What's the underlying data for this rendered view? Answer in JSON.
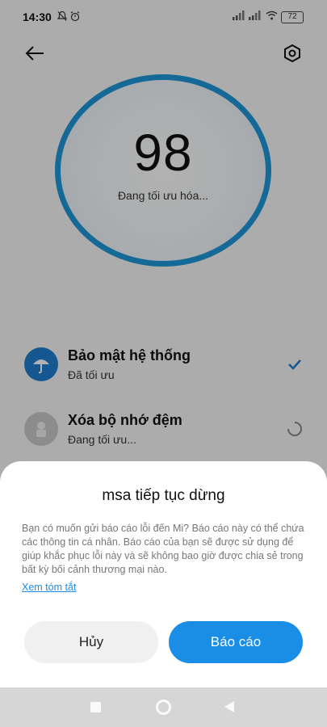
{
  "status_bar": {
    "time": "14:30",
    "icons": [
      "bell-off-icon",
      "alarm-icon"
    ],
    "right_icons": [
      "signal-icon",
      "signal-icon",
      "wifi-icon"
    ],
    "battery": "72"
  },
  "header": {
    "back_icon": "arrow-left-icon",
    "settings_icon": "settings-hexagon-icon"
  },
  "score": {
    "value": "98",
    "status": "Đang tối ưu hóa...",
    "ring_color": "#1f97d8"
  },
  "tasks": [
    {
      "title": "Bảo mật hệ thống",
      "subtitle": "Đã tối ưu",
      "icon": "umbrella-icon",
      "state_icon": "check-icon"
    },
    {
      "title": "Xóa bộ nhớ đệm",
      "subtitle": "Đang tối ưu...",
      "icon": "broom-icon",
      "state_icon": "spinner-icon"
    }
  ],
  "dialog": {
    "title": "msa tiếp tục dừng",
    "message": "Bạn có muốn gửi báo cáo lỗi đến Mi? Báo cáo này có thể chứa các thông tin cá nhân. Báo cáo của bạn sẽ được sử dụng để giúp khắc phục lỗi này và sẽ không bao giờ được chia sẻ trong bất kỳ bối cảnh thương mại nào.",
    "link": "Xem tóm tắt",
    "cancel_label": "Hủy",
    "report_label": "Báo cáo",
    "accent": "#1a8ee6"
  },
  "nav": {
    "icons": [
      "recents-icon",
      "home-icon",
      "back-icon"
    ]
  }
}
